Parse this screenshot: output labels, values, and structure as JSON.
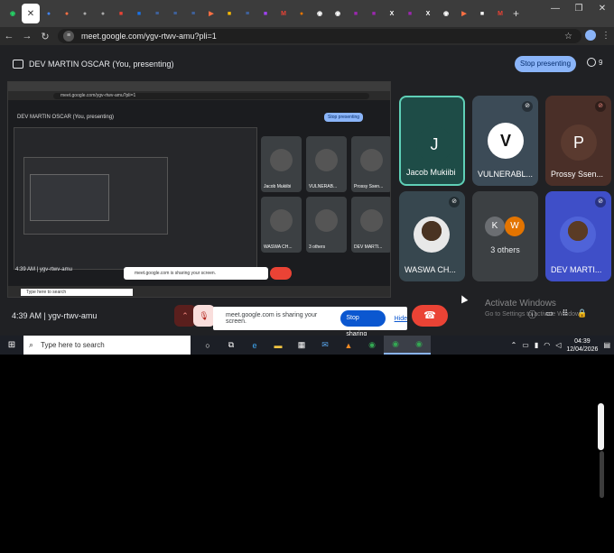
{
  "browser": {
    "tabs": [
      {
        "icon": "whatsapp-icon",
        "color": "#25d366",
        "glyph": "◉"
      },
      {
        "icon": "close-icon",
        "color": "#ffffff",
        "glyph": "✕",
        "active": true
      },
      {
        "icon": "tab-icon",
        "color": "#4285f4",
        "glyph": "●"
      },
      {
        "icon": "tab-icon",
        "color": "#ff7043",
        "glyph": "●"
      },
      {
        "icon": "tab-icon",
        "color": "#aaaaaa",
        "glyph": "●"
      },
      {
        "icon": "tab-icon",
        "color": "#aaaaaa",
        "glyph": "●"
      },
      {
        "icon": "tab-icon",
        "color": "#ea4335",
        "glyph": "■"
      },
      {
        "icon": "tab-icon",
        "color": "#1a73e8",
        "glyph": "■"
      },
      {
        "icon": "docs-icon",
        "color": "#4285f4",
        "glyph": "≡"
      },
      {
        "icon": "docs-icon",
        "color": "#4285f4",
        "glyph": "≡"
      },
      {
        "icon": "docs-icon",
        "color": "#4285f4",
        "glyph": "≡"
      },
      {
        "icon": "tab-icon",
        "color": "#ff7043",
        "glyph": "▶"
      },
      {
        "icon": "tab-icon",
        "color": "#fbbc04",
        "glyph": "■"
      },
      {
        "icon": "docs-icon",
        "color": "#4285f4",
        "glyph": "≡"
      },
      {
        "icon": "tab-icon",
        "color": "#a142f4",
        "glyph": "■"
      },
      {
        "icon": "gmail-icon",
        "color": "#ea4335",
        "glyph": "M"
      },
      {
        "icon": "tab-icon",
        "color": "#e37400",
        "glyph": "●"
      },
      {
        "icon": "github-icon",
        "color": "#ffffff",
        "glyph": "◉"
      },
      {
        "icon": "github-icon",
        "color": "#ffffff",
        "glyph": "◉"
      },
      {
        "icon": "tab-icon",
        "color": "#9c27b0",
        "glyph": "■"
      },
      {
        "icon": "tab-icon",
        "color": "#9c27b0",
        "glyph": "■"
      },
      {
        "icon": "x-icon",
        "color": "#ffffff",
        "glyph": "X"
      },
      {
        "icon": "tab-icon",
        "color": "#9c27b0",
        "glyph": "■"
      },
      {
        "icon": "x-icon",
        "color": "#ffffff",
        "glyph": "X"
      },
      {
        "icon": "github-icon",
        "color": "#ffffff",
        "glyph": "◉"
      },
      {
        "icon": "tab-icon",
        "color": "#ff7043",
        "glyph": "▶"
      },
      {
        "icon": "tab-icon",
        "color": "#ffffff",
        "glyph": "■"
      },
      {
        "icon": "gmail-icon",
        "color": "#ea4335",
        "glyph": "M"
      }
    ],
    "url": "meet.google.com/ygv-rtwv-amu?pli=1"
  },
  "meet": {
    "presenting_label": "DEV MARTIN OSCAR (You, presenting)",
    "stop_presenting": "Stop presenting",
    "participants_count": "9",
    "tiles": [
      {
        "name": "Jacob Mukiibi",
        "kind": "letter",
        "letter": "J",
        "bg": "#1e4c47",
        "circle": "#1e4c47",
        "speaking": true,
        "mic": ""
      },
      {
        "name": "VULNERABL...",
        "kind": "logo",
        "bg": "#3c4b57",
        "mic": "mic-off-icon"
      },
      {
        "name": "Prossy Ssen...",
        "kind": "letter",
        "letter": "P",
        "bg": "#4a2f28",
        "circle": "#5a3a2f",
        "mic": "mic-off-icon",
        "micred": true
      },
      {
        "name": "WASWA CH...",
        "kind": "photo",
        "bg": "#37474f",
        "mic": "mic-off-icon"
      },
      {
        "name": "3 others",
        "kind": "others",
        "bg": "#3c4043",
        "others": [
          "K",
          "W"
        ]
      },
      {
        "name": "DEV MARTI...",
        "kind": "photo-blue",
        "bg": "#3f4fc8",
        "mic": "mic-off-icon"
      }
    ],
    "preview": {
      "url": "meet.google.com/ygv-rtwv-amu?pli=1",
      "presenting_label": "DEV MARTIN OSCAR (You, presenting)",
      "stop_presenting": "Stop presenting",
      "time": "4:39 AM | ygv-rtwv-amu",
      "search": "Type here to search",
      "sharing": "meet.google.com is sharing your screen.",
      "tiles": [
        "Jacob Mukiibi",
        "VULNERAB...",
        "Prossy Ssen...",
        "WASWA CH...",
        "3 others",
        "DEV MARTI..."
      ]
    },
    "time_code": "4:39 AM | ygv-rtwv-amu",
    "share_text": "meet.google.com is sharing your screen.",
    "stop_sharing": "Stop sharing",
    "hide": "Hide",
    "activate_title": "Activate Windows",
    "activate_sub": "Go to Settings to activate Windows."
  },
  "taskbar": {
    "search_placeholder": "Type here to search",
    "time": "04:39",
    "date": "12/04/2026"
  }
}
